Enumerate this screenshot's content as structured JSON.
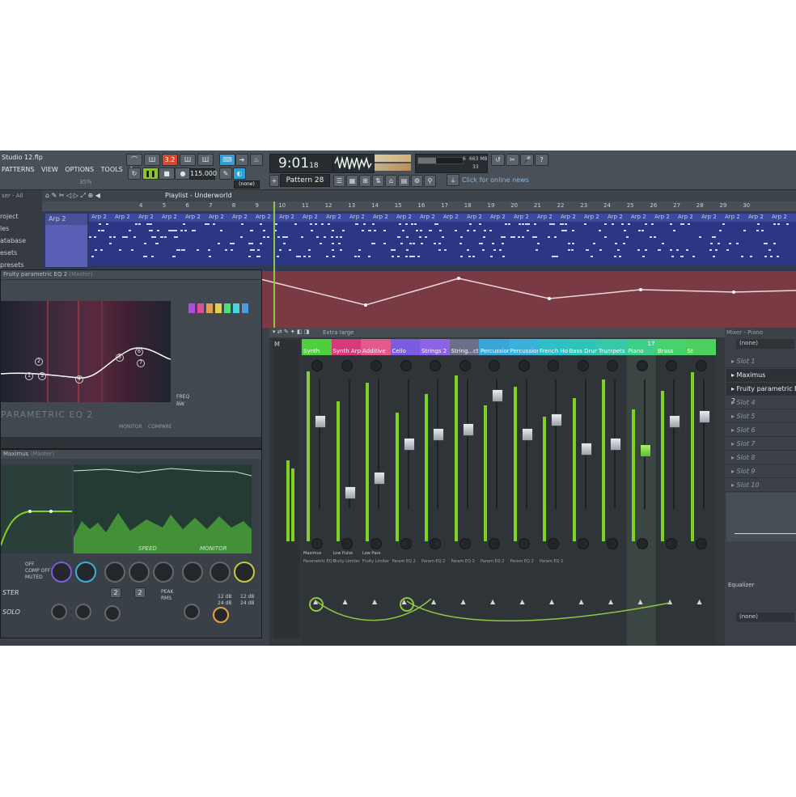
{
  "toolbar": {
    "file_name": "Studio 12.flp",
    "menu": [
      "PATTERNS",
      "VIEW",
      "OPTIONS",
      "TOOLS",
      "?"
    ],
    "cpu_label": "35%",
    "tempo": "115.000",
    "song_position": "9:01",
    "song_position_frac": "18",
    "pattern": "Pattern 28",
    "pattern_mode": "(none)",
    "mem": "663 MB",
    "cpu_num": "6",
    "polyphony": "33",
    "news": "Click for online news",
    "step_label": "3.2"
  },
  "browser": {
    "header": "ser - All",
    "items": [
      "roject",
      "les",
      "atabase",
      "esets",
      "presets"
    ]
  },
  "playlist": {
    "title": "Playlist - Underworld",
    "track": "Arp 2",
    "clip_label": "Arp 2",
    "bar_numbers": [
      "4",
      "5",
      "6",
      "7",
      "8",
      "9",
      "10",
      "11",
      "12",
      "13",
      "14",
      "15",
      "16",
      "17",
      "18",
      "19",
      "20",
      "21",
      "22",
      "23",
      "24",
      "25",
      "26",
      "27",
      "28",
      "29",
      "30"
    ]
  },
  "eq_window": {
    "title": "Fruity parametric EQ 2",
    "title_sub": "(Master)",
    "brand": "PARAMETRIC EQ 2",
    "band_nums": [
      "1",
      "2",
      "3",
      "4",
      "5",
      "6",
      "7"
    ],
    "freq_label": "FREQ",
    "bw_label": "BW",
    "monitor": "MONITOR",
    "compare": "COMPARE"
  },
  "maximus": {
    "title": "Maximus",
    "title_sub": "(Master)",
    "speed": "SPEED",
    "monitor": "MONITOR",
    "off": "OFF",
    "comp_off": "COMP OFF",
    "muted": "MUTED",
    "peak": "PEAK",
    "rms": "RMS",
    "ster": "STER",
    "solo": "SOLO",
    "db1": "12 dB",
    "db2": "24 dB",
    "db3": "12 dB",
    "db4": "24 dB",
    "num2a": "2",
    "num2b": "2"
  },
  "mixer": {
    "view": "Extra large",
    "tracks": [
      {
        "name": "Synth",
        "color": "#4ecf3e"
      },
      {
        "name": "Synth Arp",
        "color": "#d73a7a"
      },
      {
        "name": "Additive",
        "color": "#e25a8a"
      },
      {
        "name": "Cello",
        "color": "#7a5ce0"
      },
      {
        "name": "Strings 2",
        "color": "#8b63e6"
      },
      {
        "name": "String...ction",
        "color": "#6b6f8a"
      },
      {
        "name": "Percussion",
        "color": "#3aa6d8"
      },
      {
        "name": "Percussion 2",
        "color": "#3ab0dc"
      },
      {
        "name": "French Horn",
        "color": "#2fbfc6"
      },
      {
        "name": "Bass Drum",
        "color": "#2fc4b8"
      },
      {
        "name": "Trumpets",
        "color": "#36c8a8"
      },
      {
        "name": "Piano",
        "color": "#3ed08a"
      },
      {
        "name": "Brass",
        "color": "#45d36e"
      },
      {
        "name": "St",
        "color": "#4ecf5e"
      }
    ],
    "piano_number": "17",
    "master_label": "M",
    "fx_labels": [
      "Parametric EQ 2",
      "Fruity Limiter",
      "Fruity Limiter",
      "Param EQ 2",
      "Param EQ 2",
      "Param EQ 2",
      "Param EQ 2",
      "Param EQ 2",
      "Param EQ 2"
    ],
    "row_labels": [
      "Maximus",
      "Low Pulse",
      "Low Pass"
    ]
  },
  "fx_panel": {
    "title": "Mixer - Piano",
    "input": "(none)",
    "slots": [
      "Slot 1",
      "Maximus",
      "Fruity parametric EQ 2",
      "Slot 4",
      "Slot 5",
      "Slot 6",
      "Slot 7",
      "Slot 8",
      "Slot 9",
      "Slot 10"
    ],
    "equalizer": "Equalizer",
    "output": "(none)",
    "output_label": "(none)"
  }
}
